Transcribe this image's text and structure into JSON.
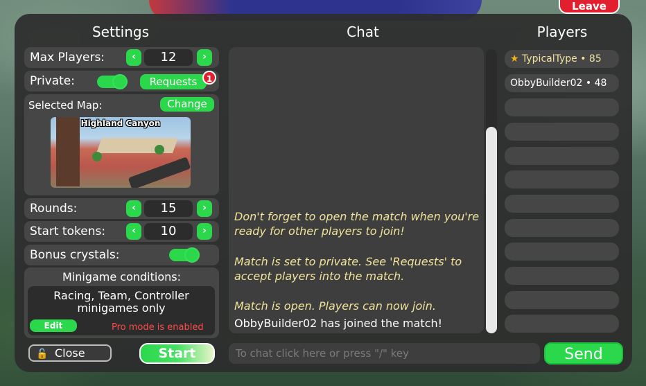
{
  "top": {
    "leave_label": "Leave"
  },
  "headers": {
    "settings": "Settings",
    "chat": "Chat",
    "players": "Players"
  },
  "settings": {
    "max_players": {
      "label": "Max Players:",
      "value": "12"
    },
    "private": {
      "label": "Private:",
      "enabled": true,
      "requests_label": "Requests",
      "requests_badge": "1"
    },
    "selected_map": {
      "label": "Selected Map:",
      "change_label": "Change",
      "map_name": "Highland Canyon"
    },
    "rounds": {
      "label": "Rounds:",
      "value": "15"
    },
    "start_tokens": {
      "label": "Start tokens:",
      "value": "10"
    },
    "bonus_crystals": {
      "label": "Bonus crystals:",
      "enabled": true
    },
    "minigame": {
      "title": "Minigame conditions:",
      "description": "Racing, Team, Controller minigames only",
      "edit_label": "Edit",
      "pro_mode_text": "Pro mode is enabled"
    },
    "close_label": "Close",
    "start_label": "Start",
    "arrow_left": "‹",
    "arrow_right": "›"
  },
  "chat": {
    "system_messages": [
      "Don't forget to open the match when you're ready for other players to join!",
      "Match is set to private. See 'Requests' to accept players into the match.",
      "Match is open. Players can now join."
    ],
    "messages": [
      "ObbyBuilder02 has joined the match!"
    ],
    "input_placeholder": "To chat click here or press \"/\" key",
    "send_label": "Send"
  },
  "players": {
    "list": [
      {
        "name": "TypicalType • 85",
        "host": true
      },
      {
        "name": "ObbyBuilder02 • 48",
        "host": false
      }
    ],
    "empty_slots": 10
  },
  "colors": {
    "accent_green": "#2bd84c",
    "danger_red": "#e21f2f",
    "system_text": "#efe39a",
    "pro_mode_red": "#ff4a4a"
  }
}
